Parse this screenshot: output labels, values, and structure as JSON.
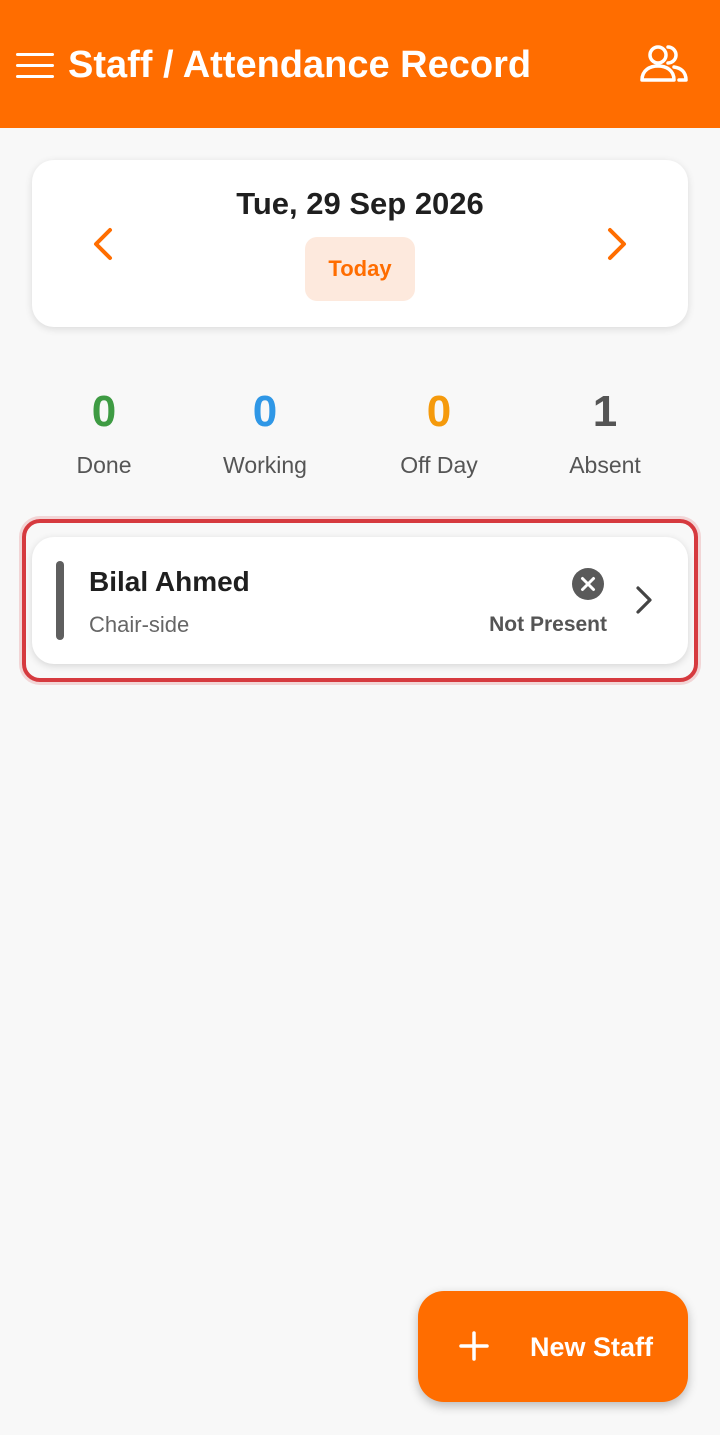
{
  "header": {
    "title": "Staff / Attendance Record",
    "menu_icon": "menu-icon",
    "people_icon": "people-icon",
    "background": "#ff6d00"
  },
  "date_selector": {
    "date": "Tue, 29 Sep 2026",
    "today_label": "Today",
    "prev_icon": "chevron-left-icon",
    "next_icon": "chevron-right-icon"
  },
  "stats": [
    {
      "value": "0",
      "label": "Done",
      "color": "#3e9b43"
    },
    {
      "value": "0",
      "label": "Working",
      "color": "#2f97e6"
    },
    {
      "value": "0",
      "label": "Off Day",
      "color": "#f59a0c"
    },
    {
      "value": "1",
      "label": "Absent",
      "color": "#555555"
    }
  ],
  "staff": [
    {
      "name": "Bilal Ahmed",
      "role": "Chair-side",
      "status": "Not Present",
      "status_icon": "x-circle-icon",
      "bar_color": "#5f5f5f"
    }
  ],
  "fab": {
    "label": "New Staff",
    "icon": "plus-icon"
  }
}
